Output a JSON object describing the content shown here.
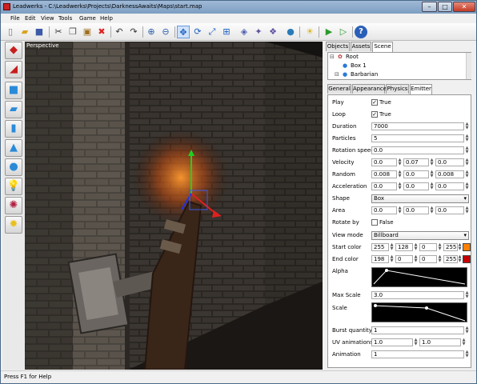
{
  "window": {
    "title": "Leadwerks - C:\\Leadwerks\\Projects\\DarknessAwaits\\Maps\\start.map",
    "minimize": "–",
    "maximize": "□",
    "close": "✕"
  },
  "menu": [
    "File",
    "Edit",
    "View",
    "Tools",
    "Game",
    "Help"
  ],
  "toolbar_icons": [
    "new-file-icon",
    "open-folder-icon",
    "save-icon",
    "cut-icon",
    "copy-icon",
    "paste-icon",
    "delete-icon",
    "undo-icon",
    "redo-icon",
    "zoom-in-icon",
    "zoom-out-icon",
    "select-move-icon",
    "select-rotate-icon",
    "select-scale-icon",
    "snap-icon",
    "grid-icon",
    "vertex-icon",
    "material-icon",
    "sun-icon",
    "play-icon",
    "run-icon",
    "help-icon"
  ],
  "left_tools": [
    "box-brush-icon",
    "wedge-brush-icon",
    "cube-brush-icon",
    "slab-brush-icon",
    "cylinder-brush-icon",
    "cone-brush-icon",
    "sphere-brush-icon",
    "light-bulb-icon",
    "particle-icon",
    "sun-light-icon"
  ],
  "viewport": {
    "label": "Perspective"
  },
  "panel_tabs": [
    "Objects",
    "Assets",
    "Scene"
  ],
  "panel_active_tab": "Scene",
  "scene_tree": [
    "Root",
    "Box 1",
    "Barbarian"
  ],
  "prop_tabs": [
    "General",
    "Appearance",
    "Physics",
    "Emitter"
  ],
  "prop_active_tab": "Emitter",
  "properties": {
    "play": {
      "label": "Play",
      "checked": true,
      "text": "True"
    },
    "loop": {
      "label": "Loop",
      "checked": true,
      "text": "True"
    },
    "duration": {
      "label": "Duration",
      "value": "7000"
    },
    "particles": {
      "label": "Particles",
      "value": "5"
    },
    "rotation_speed": {
      "label": "Rotation speed",
      "value": "0.0"
    },
    "velocity": {
      "label": "Velocity",
      "x": "0.0",
      "y": "0.07",
      "z": "0.0"
    },
    "random": {
      "label": "Random",
      "x": "0.008",
      "y": "0.0",
      "z": "0.008"
    },
    "acceleration": {
      "label": "Acceleration",
      "x": "0.0",
      "y": "0.0",
      "z": "0.0"
    },
    "shape": {
      "label": "Shape",
      "value": "Box"
    },
    "area": {
      "label": "Area",
      "x": "0.0",
      "y": "0.0",
      "z": "0.0"
    },
    "rotate_by": {
      "label": "Rotate by",
      "checked": false,
      "text": "False"
    },
    "view_mode": {
      "label": "View mode",
      "value": "Billboard"
    },
    "start_color": {
      "label": "Start color",
      "r": "255",
      "g": "128",
      "b": "0",
      "a": "255",
      "swatch": "#ff8000"
    },
    "end_color": {
      "label": "End color",
      "r": "198",
      "g": "0",
      "b": "0",
      "a": "255",
      "swatch": "#c60000"
    },
    "alpha": {
      "label": "Alpha"
    },
    "max_scale": {
      "label": "Max Scale",
      "value": "3.0"
    },
    "scale": {
      "label": "Scale"
    },
    "burst_quantity": {
      "label": "Burst quantity",
      "value": "1"
    },
    "uv_animations": {
      "label": "UV animations",
      "x": "1.0",
      "y": "1.0"
    },
    "animation": {
      "label": "Animation",
      "value": "1"
    }
  },
  "status": "Press F1 for Help"
}
